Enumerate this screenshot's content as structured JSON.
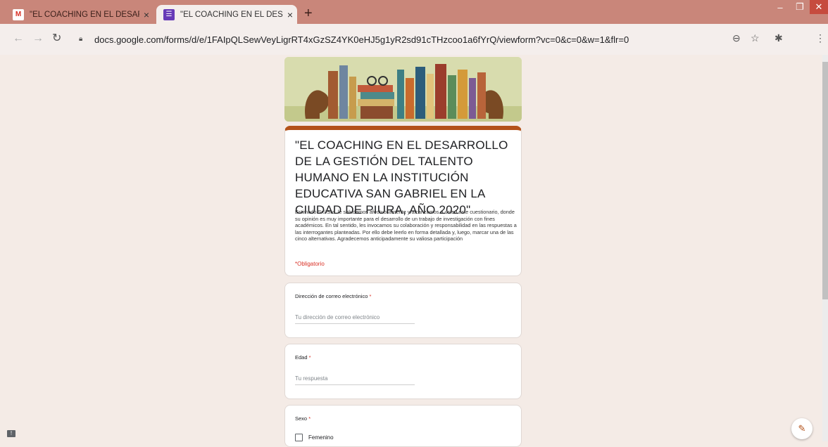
{
  "browser": {
    "tabs": [
      {
        "title": "\"EL COACHING EN EL DESARROL",
        "icon": "gmail-icon",
        "close": "×"
      },
      {
        "title": "\"EL COACHING EN EL DESARROL",
        "icon": "google-forms-icon",
        "close": "×"
      }
    ],
    "new_tab": "+",
    "url": "docs.google.com/forms/d/e/1FAIpQLSewVeyLigrRT4xGzSZ4YK0eHJ5g1yR2sd91cTHzcoo1a6fYrQ/viewform?vc=0&c=0&w=1&flr=0"
  },
  "form": {
    "title": "\"EL COACHING EN EL DESARROLLO DE LA GESTIÓN DEL TALENTO HUMANO EN LA INSTITUCIÓN EDUCATIVA SAN GABRIEL EN LA CIUDAD DE PIURA, AÑO 2020\"",
    "description": "Estimado Sr./ Sra. le saludamos afectuosamente y alcanzamos a usted este cuestionario, donde su opinión es muy importante para el desarrollo de un trabajo de investigación con fines académicos. En tal sentido, les invocamos su colaboración y responsabilidad en las respuestas a las interrogantes planteadas. Por ello debe leerlo en forma detallada y, luego, marcar una de las cinco alternativas. Agradecemos anticipadamente su valiosa participación",
    "required_note": "*Obligatorio",
    "questions": {
      "email": {
        "label": "Dirección de correo electrónico",
        "star": " *",
        "placeholder": "Tu dirección de correo electrónico"
      },
      "age": {
        "label": "Edad",
        "star": " *",
        "placeholder": "Tu respuesta"
      },
      "sex": {
        "label": "Sexo",
        "star": " *",
        "option1": "Femenino"
      }
    }
  },
  "colors": {
    "accent": "#b3521a",
    "tabbar": "#c9867a",
    "page_bg": "#f4ebe6",
    "required": "#d93025"
  }
}
